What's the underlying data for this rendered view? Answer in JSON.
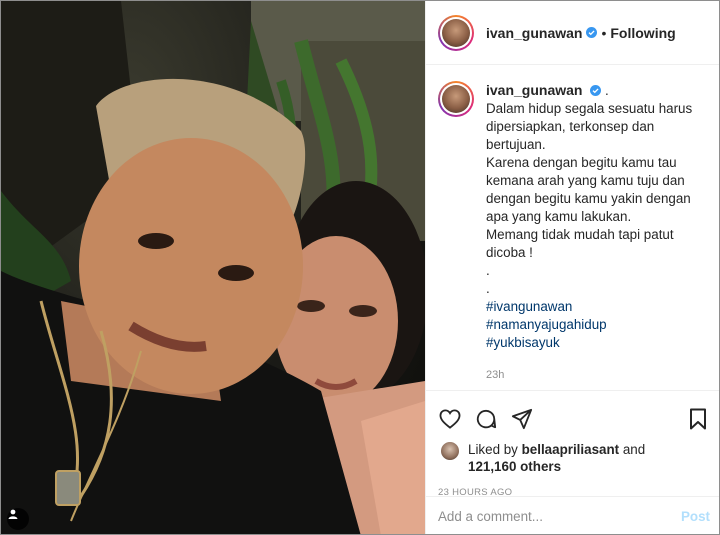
{
  "post": {
    "author": "ivan_gunawan",
    "verified": true,
    "separator": "•",
    "follow_status": "Following"
  },
  "caption": {
    "username": "ivan_gunawan",
    "suffix": ".",
    "lines": [
      "Dalam hidup segala sesuatu harus dipersiapkan, terkonsep dan bertujuan.",
      "Karena dengan begitu kamu tau kemana arah yang kamu tuju dan dengan begitu kamu yakin dengan apa yang kamu lakukan.",
      "Memang tidak mudah tapi patut dicoba !",
      ".",
      "."
    ],
    "hashtags": [
      "#ivangunawan",
      "#namanyajugahidup",
      "#yukbisayuk"
    ],
    "age": "23h"
  },
  "comment": {
    "username": "bellaapriliasant",
    "text": "🤍🤍"
  },
  "likes": {
    "prefix": "Liked by",
    "user": "bellaapriliasant",
    "and": "and",
    "others": "121,160 others"
  },
  "timestamp": "23 HOURS AGO",
  "add_comment": {
    "placeholder": "Add a comment...",
    "post_label": "Post"
  },
  "icons": {
    "like": "heart-icon",
    "comment": "comment-icon",
    "share": "share-icon",
    "save": "bookmark-icon",
    "verified": "verified-badge-icon",
    "tagged": "user-tag-icon"
  },
  "colors": {
    "verified_blue": "#3897f0",
    "hashtag": "#00376b",
    "post_button_disabled": "#b2dffc",
    "muted_text": "#8e8e8e",
    "border": "#efefef"
  }
}
